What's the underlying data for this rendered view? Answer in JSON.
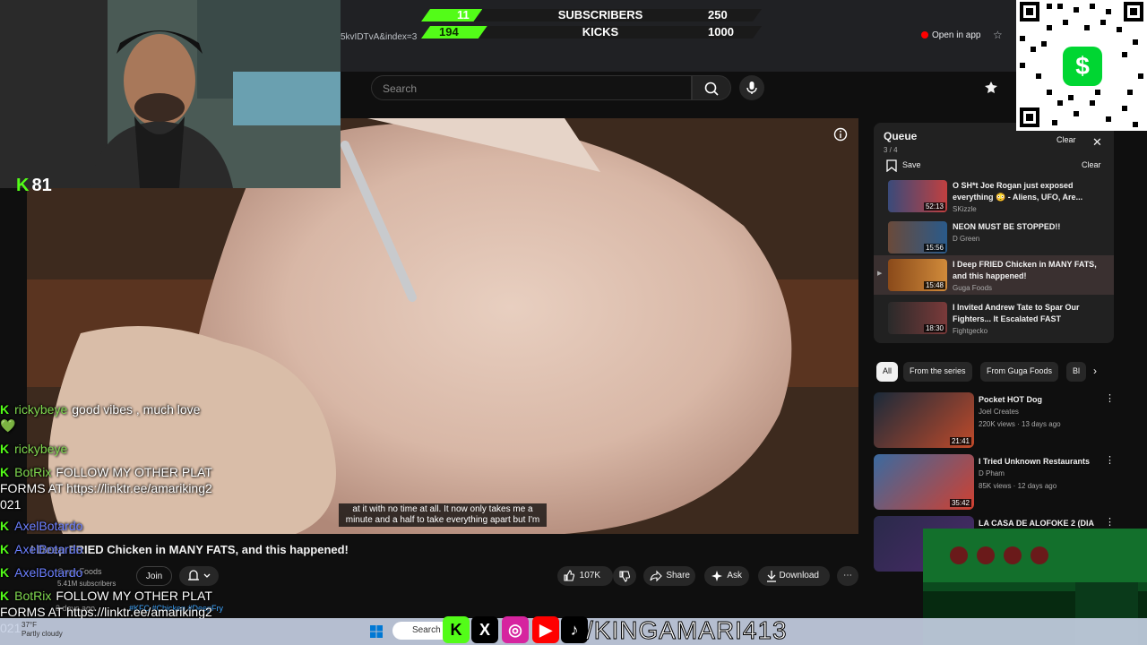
{
  "goals": {
    "subscribers": {
      "current": "11",
      "label": "SUBSCRIBERS",
      "target": "250",
      "progress": 0.044
    },
    "kicks": {
      "current": "194",
      "label": "KICKS",
      "target": "1000",
      "progress": 0.194
    }
  },
  "browser": {
    "url": "5kvIDTvA&index=3",
    "open_in_app": "Open in app"
  },
  "yt": {
    "search_placeholder": "Search",
    "video_title": "I Deep FRIED Chicken in MANY FATS, and this happened!",
    "channel": "Guga Foods",
    "subscribers": "5.41M subscribers",
    "join": "Join",
    "likes": "107K",
    "share": "Share",
    "ask": "Ask",
    "download": "Download",
    "desc_meta": "3 days ago",
    "desc_tags": "#KFC #Chicken #DeepFry",
    "captions_line1": "at it with no time at all. It now only takes me a",
    "captions_line2": "minute and a half to take everything apart but I'm"
  },
  "queue": {
    "title": "Queue",
    "count": "3 / 4",
    "clear_top": "Clear",
    "save": "Save",
    "clear": "Clear",
    "items": [
      {
        "title": "O SH*t Joe Rogan just exposed everything 😳 - Aliens, UFO, Are...",
        "channel": "SKizzle",
        "duration": "52:13"
      },
      {
        "title": "NEON MUST BE STOPPED!!",
        "channel": "D Green",
        "duration": "15:56"
      },
      {
        "title": "I Deep FRIED Chicken in MANY FATS, and this happened!",
        "channel": "Guga Foods",
        "duration": "15:48"
      },
      {
        "title": "I Invited Andrew Tate to Spar Our Fighters... It Escalated FAST",
        "channel": "Fightgecko",
        "duration": "18:30"
      }
    ]
  },
  "chips": [
    "All",
    "From the series",
    "From Guga Foods",
    "Bl"
  ],
  "recs": [
    {
      "title": "Pocket HOT Dog",
      "channel": "Joel Creates",
      "meta": "220K views · 13 days ago",
      "duration": "21:41"
    },
    {
      "title": "I Tried Unknown Restaurants",
      "channel": "D Pham",
      "meta": "85K views · 12 days ago",
      "duration": "35:42"
    },
    {
      "title": "LA CASA DE ALOFOKE 2 (DIA",
      "channel": "",
      "meta": "",
      "duration": ""
    }
  ],
  "stream": {
    "viewers": "81",
    "social_handle": "/KINGAMARI413"
  },
  "chat": [
    {
      "user": "rickybeye",
      "msg": "good vibes , much love 💚",
      "color": "green"
    },
    {
      "user": "rickybeye",
      "msg": "",
      "color": "green"
    },
    {
      "user": "BotRix",
      "msg": "FOLLOW MY OTHER PLATFORMS AT https://linktr.ee/amariking2021",
      "color": "green"
    },
    {
      "user": "AxelBotardo",
      "msg": "",
      "color": "blue"
    },
    {
      "user": "AxelBotardo",
      "msg": "",
      "color": "blue"
    },
    {
      "user": "AxelBotardo",
      "msg": "",
      "color": "blue"
    },
    {
      "user": "BotRix",
      "msg": "FOLLOW MY OTHER PLATFORMS AT https://linktr.ee/amariking2021",
      "color": "green"
    }
  ],
  "taskbar": {
    "weather_temp": "37°F",
    "weather_desc": "Partly cloudy",
    "search": "Search"
  },
  "colors": {
    "kick_green": "#53fc18",
    "yt_red": "#ff0000",
    "cashapp": "#00d632"
  }
}
